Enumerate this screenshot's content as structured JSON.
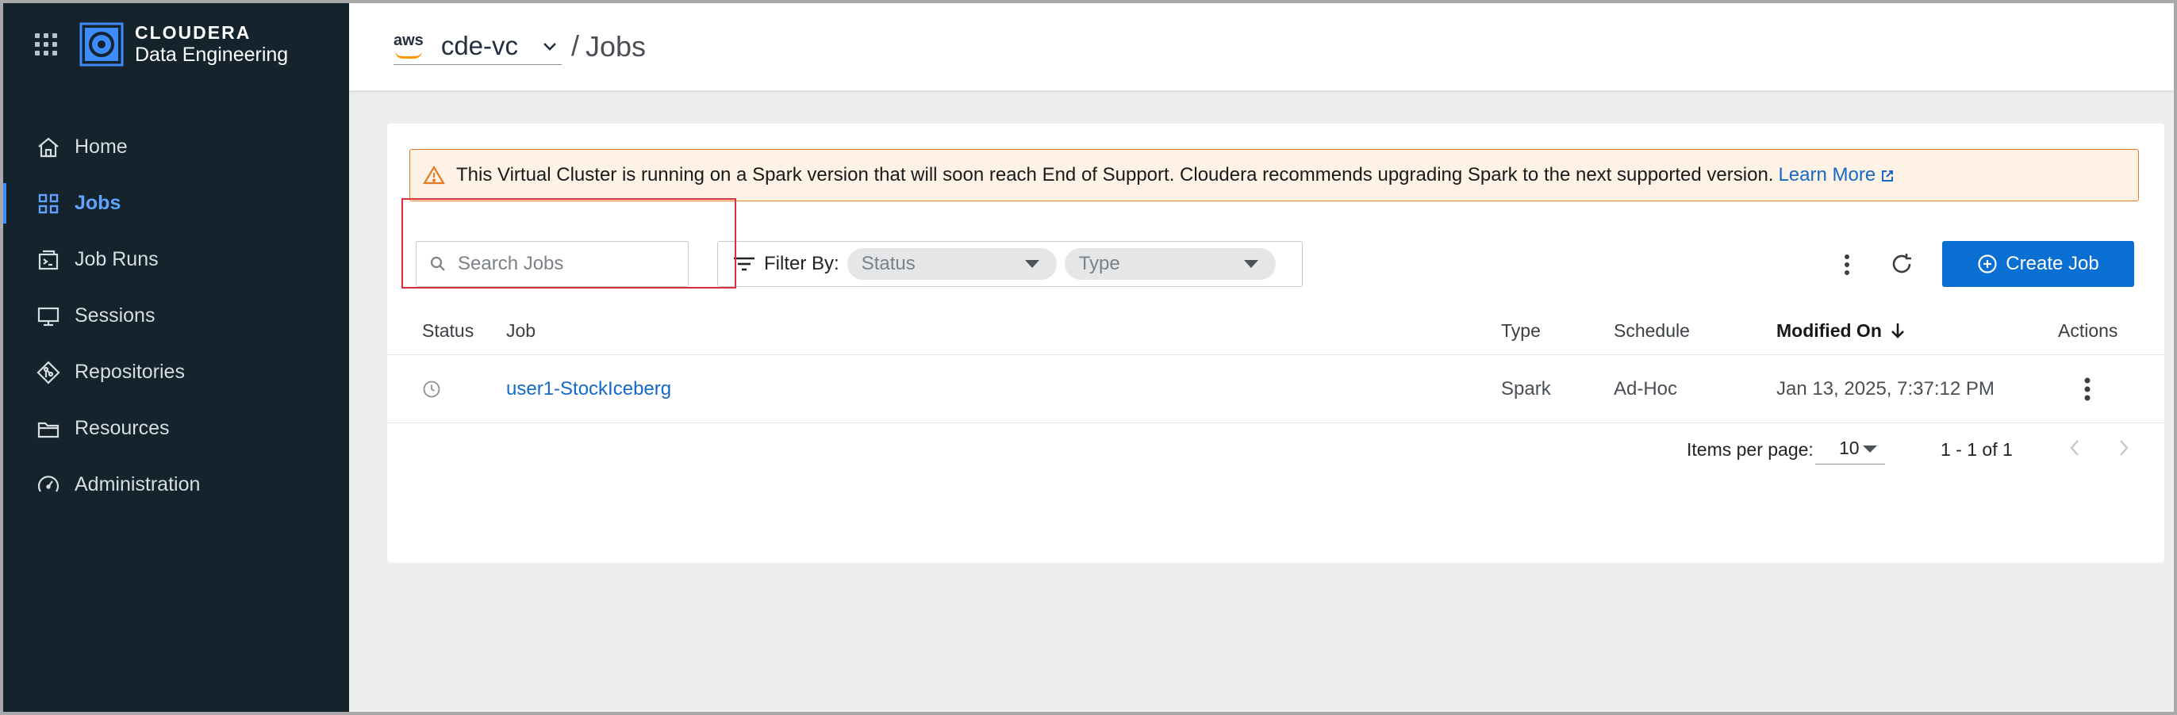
{
  "app": {
    "brand_name": "CLOUDERA",
    "brand_sub": "Data Engineering"
  },
  "sidebar": {
    "items": [
      {
        "label": "Home",
        "icon": "home-icon",
        "active": false
      },
      {
        "label": "Jobs",
        "icon": "jobs-grid-icon",
        "active": true
      },
      {
        "label": "Job Runs",
        "icon": "job-runs-icon",
        "active": false
      },
      {
        "label": "Sessions",
        "icon": "monitor-icon",
        "active": false
      },
      {
        "label": "Repositories",
        "icon": "git-icon",
        "active": false
      },
      {
        "label": "Resources",
        "icon": "folder-icon",
        "active": false
      },
      {
        "label": "Administration",
        "icon": "gauge-icon",
        "active": false
      }
    ]
  },
  "header": {
    "cloud_provider": "aws",
    "cluster": "cde-vc",
    "separator": "/",
    "page_title": "Jobs"
  },
  "alert": {
    "message": "This Virtual Cluster is running on a Spark version that will soon reach End of Support. Cloudera recommends upgrading Spark to the next supported version.",
    "link_label": "Learn More"
  },
  "toolbar": {
    "search_placeholder": "Search Jobs",
    "filter_label": "Filter By:",
    "filter_status": "Status",
    "filter_type": "Type",
    "create_label": "Create Job"
  },
  "table": {
    "columns": {
      "status": "Status",
      "job": "Job",
      "type": "Type",
      "schedule": "Schedule",
      "modified": "Modified On",
      "actions": "Actions"
    },
    "rows": [
      {
        "status_icon": "clock-icon",
        "job": "user1-StockIceberg",
        "type": "Spark",
        "schedule": "Ad-Hoc",
        "modified": "Jan 13, 2025, 7:37:12 PM"
      }
    ]
  },
  "pagination": {
    "items_per_page_label": "Items per page:",
    "items_per_page": "10",
    "range": "1 - 1 of 1"
  },
  "colors": {
    "sidebar_bg": "#15232d",
    "accent": "#0a6fd3",
    "link": "#1469c7",
    "warning_border": "#e57c21",
    "warning_bg": "#fdf2e5",
    "highlight": "#d7313c"
  }
}
